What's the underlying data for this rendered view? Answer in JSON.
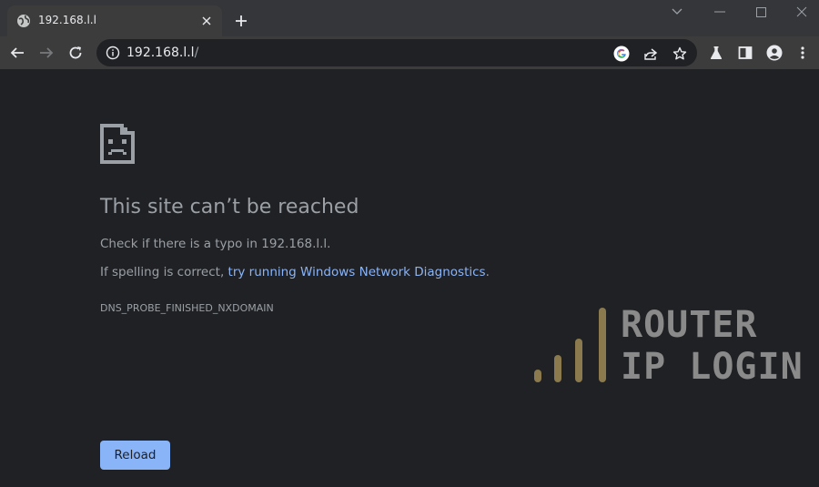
{
  "tab": {
    "title": "192.168.l.l"
  },
  "omnibox": {
    "host": "192.168.l.l",
    "path": "/"
  },
  "error": {
    "title": "This site can’t be reached",
    "line1": "Check if there is a typo in 192.168.l.l.",
    "line2_prefix": "If spelling is correct, ",
    "line2_link": "try running Windows Network Diagnostics",
    "line2_suffix": ".",
    "code": "DNS_PROBE_FINISHED_NXDOMAIN",
    "reload_label": "Reload"
  },
  "watermark": {
    "line1": "ROUTER",
    "line2": "IP LOGIN"
  },
  "colors": {
    "link": "#8ab4f8",
    "button": "#8ab4f8",
    "watermark_bars": "#8b7a4e",
    "watermark_text": "#8a8a8a"
  }
}
